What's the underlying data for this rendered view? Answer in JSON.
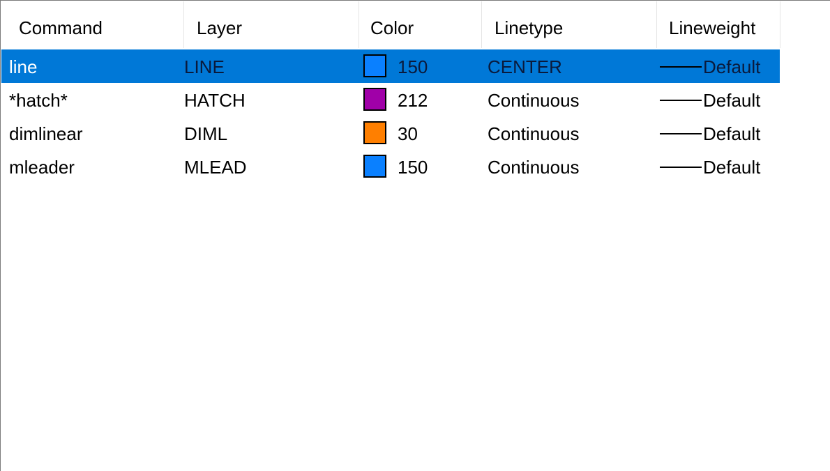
{
  "columns": {
    "command": "Command",
    "layer": "Layer",
    "color": "Color",
    "linetype": "Linetype",
    "lineweight": "Lineweight"
  },
  "selection_color": "#0078d7",
  "rows": [
    {
      "command": "line",
      "layer": "LINE",
      "color_num": "150",
      "swatch": "#0a80ff",
      "linetype": "CENTER",
      "lineweight": "Default",
      "selected": true
    },
    {
      "command": "*hatch*",
      "layer": "HATCH",
      "color_num": "212",
      "swatch": "#a000a8",
      "linetype": "Continuous",
      "lineweight": "Default",
      "selected": false
    },
    {
      "command": "dimlinear",
      "layer": "DIML",
      "color_num": "30",
      "swatch": "#ff7f00",
      "linetype": "Continuous",
      "lineweight": "Default",
      "selected": false
    },
    {
      "command": "mleader",
      "layer": "MLEAD",
      "color_num": "150",
      "swatch": "#0a80ff",
      "linetype": "Continuous",
      "lineweight": "Default",
      "selected": false
    }
  ]
}
